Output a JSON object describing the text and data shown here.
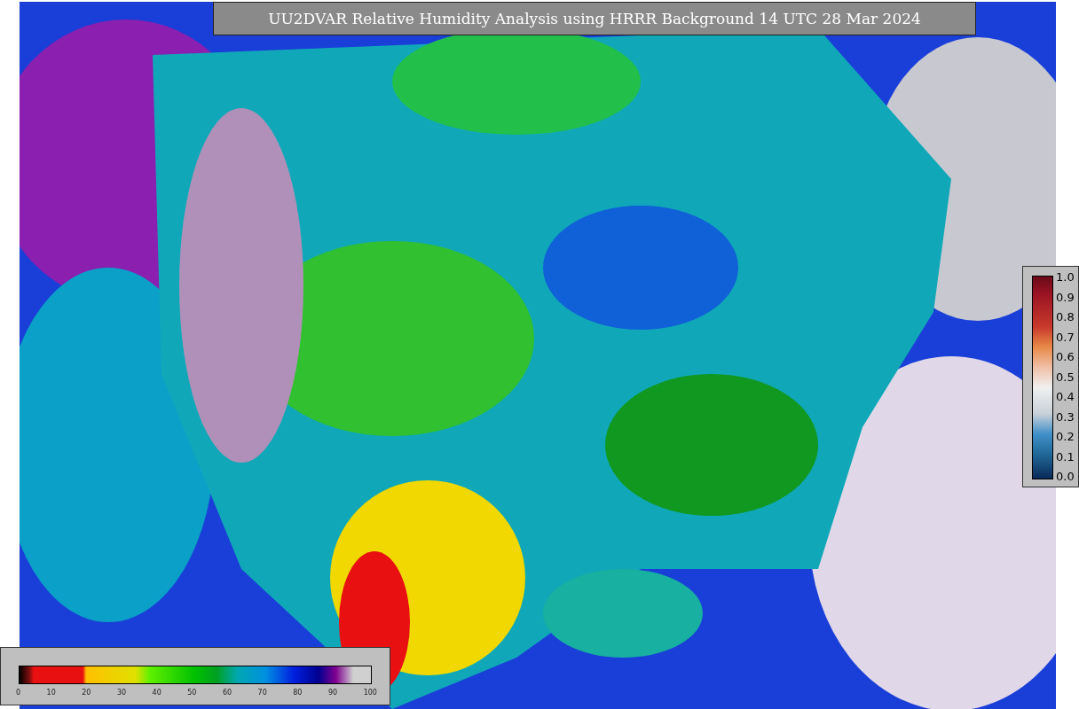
{
  "title": "UU2DVAR Relative Humidity Analysis using HRRR Background 14 UTC 28 Mar 2024",
  "fraction_colorbar": {
    "ticks": [
      "1.0",
      "0.9",
      "0.8",
      "0.7",
      "0.6",
      "0.5",
      "0.4",
      "0.3",
      "0.2",
      "0.1",
      "0.0"
    ]
  },
  "humidity_colorbar": {
    "ticks": [
      "0",
      "10",
      "20",
      "30",
      "40",
      "50",
      "60",
      "70",
      "80",
      "90",
      "100"
    ]
  }
}
